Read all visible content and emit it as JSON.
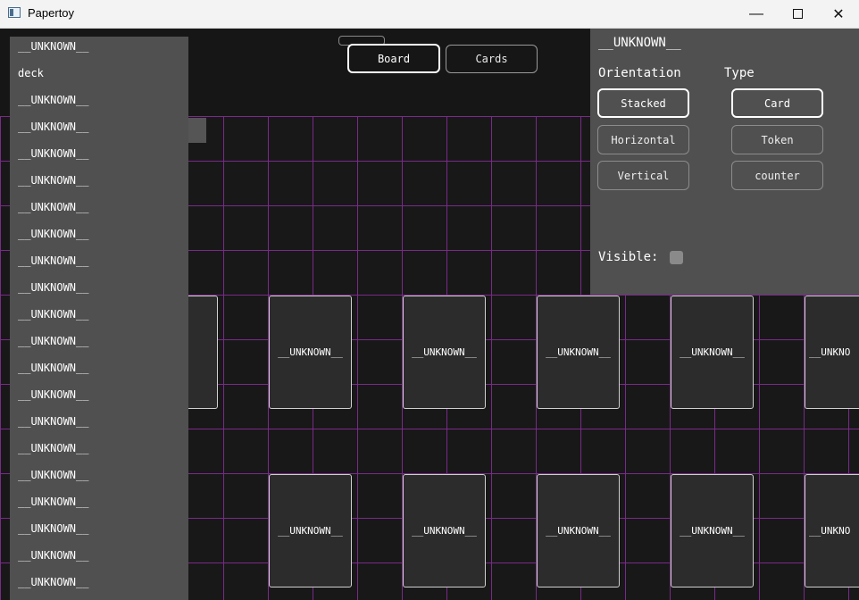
{
  "window": {
    "title": "Papertoy"
  },
  "toolbar": {
    "board_label": "Board",
    "cards_label": "Cards"
  },
  "sidebar": {
    "items": [
      "__UNKNOWN__",
      "deck",
      "__UNKNOWN__",
      "__UNKNOWN__",
      "__UNKNOWN__",
      "__UNKNOWN__",
      "__UNKNOWN__",
      "__UNKNOWN__",
      "__UNKNOWN__",
      "__UNKNOWN__",
      "__UNKNOWN__",
      "__UNKNOWN__",
      "__UNKNOWN__",
      "__UNKNOWN__",
      "__UNKNOWN__",
      "__UNKNOWN__",
      "__UNKNOWN__",
      "__UNKNOWN__",
      "__UNKNOWN__",
      "__UNKNOWN__",
      "__UNKNOWN__"
    ]
  },
  "cards": {
    "row1": [
      "",
      "__UNKNOWN__",
      "__UNKNOWN__",
      "__UNKNOWN__",
      "__UNKNOWN__",
      "__UNKNO"
    ],
    "row2": [
      "__UNKNOWN__",
      "__UNKNOWN__",
      "__UNKNOWN__",
      "__UNKNOWN__",
      "__UNKNO"
    ]
  },
  "panel": {
    "title": "__UNKNOWN__",
    "orientation_label": "Orientation",
    "type_label": "Type",
    "orientation_options": [
      "Stacked",
      "Horizontal",
      "Vertical"
    ],
    "type_options": [
      "Card",
      "Token",
      "counter"
    ],
    "selected_orientation": "Stacked",
    "selected_type": "Card",
    "visible_label": "Visible:",
    "visible_checked": false
  },
  "colors": {
    "grid_line": "#7a2a8a",
    "panel_bg": "#505050",
    "board_bg": "#181818"
  }
}
